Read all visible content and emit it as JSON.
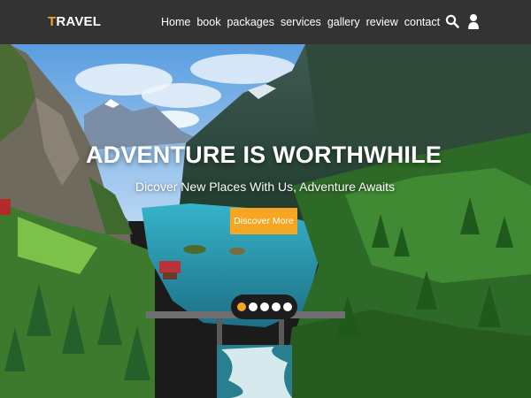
{
  "header": {
    "logo_initial": "T",
    "logo_rest": "RAVEL",
    "nav": [
      "Home",
      "book",
      "packages",
      "services",
      "gallery",
      "review",
      "contact"
    ],
    "icons": [
      "search-icon",
      "user-icon"
    ]
  },
  "hero": {
    "title": "ADVENTURE IS WORTHWHILE",
    "subtitle": "Dicover New Places With Us, Adventure Awaits",
    "button_label": "Discover More",
    "slides": 5,
    "active_slide": 1
  },
  "colors": {
    "header_bg": "#333333",
    "accent": "#f5a623",
    "text": "#ffffff"
  }
}
